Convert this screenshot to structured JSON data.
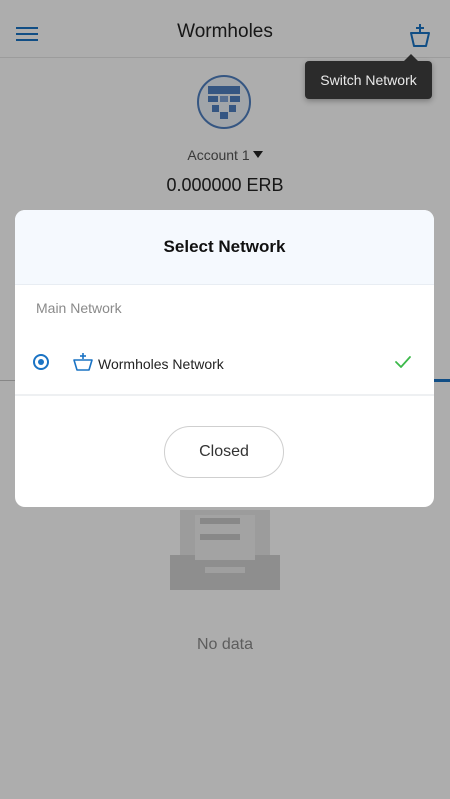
{
  "header": {
    "title": "Wormholes"
  },
  "tooltip": {
    "text": "Switch Network"
  },
  "account": {
    "name": "Account 1",
    "balance": "0.000000 ERB"
  },
  "empty_state": {
    "text": "No data"
  },
  "modal": {
    "title": "Select Network",
    "section_label": "Main Network",
    "networks": [
      {
        "label": "Wormholes Network",
        "selected": true
      }
    ],
    "close_label": "Closed"
  },
  "colors": {
    "accent": "#1a73c4",
    "check": "#3cb94a",
    "overlay": "rgba(0,0,0,0.32)",
    "tooltip_bg": "#2b2b2b"
  },
  "icons": {
    "menu": "menu-icon",
    "network": "network-basket-icon",
    "check": "check-icon"
  }
}
